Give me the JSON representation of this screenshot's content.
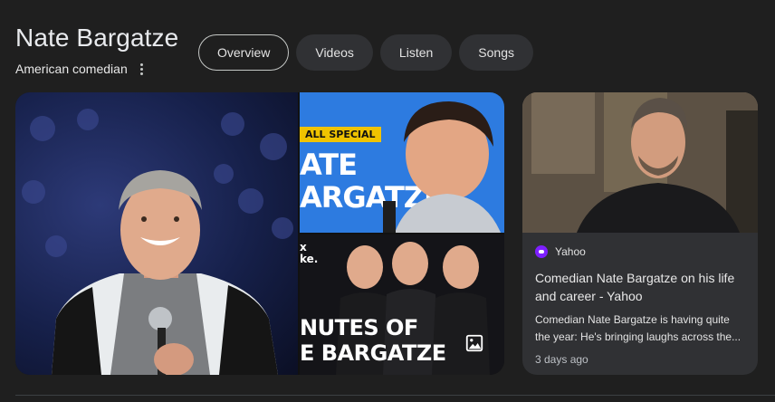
{
  "entity": {
    "name": "Nate Bargatze",
    "description": "American comedian"
  },
  "tabs": [
    {
      "label": "Overview",
      "active": true
    },
    {
      "label": "Videos",
      "active": false
    },
    {
      "label": "Listen",
      "active": false
    },
    {
      "label": "Songs",
      "active": false
    }
  ],
  "collage": {
    "top_image": {
      "badge": "ALL SPECIAL",
      "text_line1": "ATE",
      "text_line2": "ARGATZE"
    },
    "bottom_image": {
      "small_line1": "x",
      "small_line2": "ke.",
      "text_line1": "NUTES OF",
      "text_line2": "E BARGATZE"
    },
    "images_icon": "image-gallery-icon"
  },
  "news_card": {
    "source": "Yahoo",
    "title": "Comedian Nate Bargatze on his life and career - Yahoo",
    "snippet": "Comedian Nate Bargatze is having quite the year: He's bringing laughs across the...",
    "time": "3 days ago"
  },
  "colors": {
    "background": "#1f1f1f",
    "chip": "#303134",
    "card": "#303134",
    "yahoo_purple": "#7e1fff",
    "poster_blue": "#2d7be0",
    "poster_yellow": "#f0c300"
  }
}
